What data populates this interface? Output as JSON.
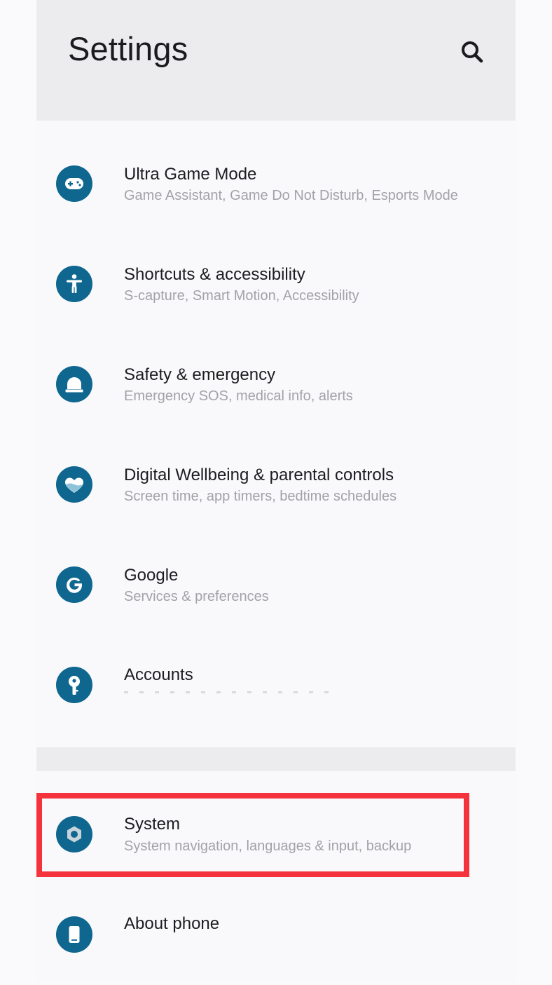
{
  "header": {
    "title": "Settings",
    "search_icon": "search-icon"
  },
  "items": [
    {
      "title": "Ultra Game Mode",
      "subtitle": "Game Assistant, Game Do Not Disturb, Esports Mode",
      "icon": "gamepad-icon"
    },
    {
      "title": "Shortcuts & accessibility",
      "subtitle": "S-capture, Smart Motion, Accessibility",
      "icon": "accessibility-icon"
    },
    {
      "title": "Safety & emergency",
      "subtitle": "Emergency SOS, medical info, alerts",
      "icon": "emergency-light-icon"
    },
    {
      "title": "Digital Wellbeing & parental controls",
      "subtitle": "Screen time, app timers, bedtime schedules",
      "icon": "wellbeing-heart-icon"
    },
    {
      "title": "Google",
      "subtitle": "Services & preferences",
      "icon": "google-icon"
    },
    {
      "title": "Accounts",
      "subtitle": "",
      "icon": "key-icon"
    },
    {
      "title": "System",
      "subtitle": "System navigation, languages & input, backup",
      "icon": "system-hexagon-icon"
    },
    {
      "title": "About phone",
      "subtitle": "",
      "icon": "phone-icon"
    }
  ],
  "colors": {
    "accent": "#0f6790",
    "highlight": "#f5333c",
    "header_bg": "#ececee",
    "list_bg": "#f9f9fb"
  }
}
